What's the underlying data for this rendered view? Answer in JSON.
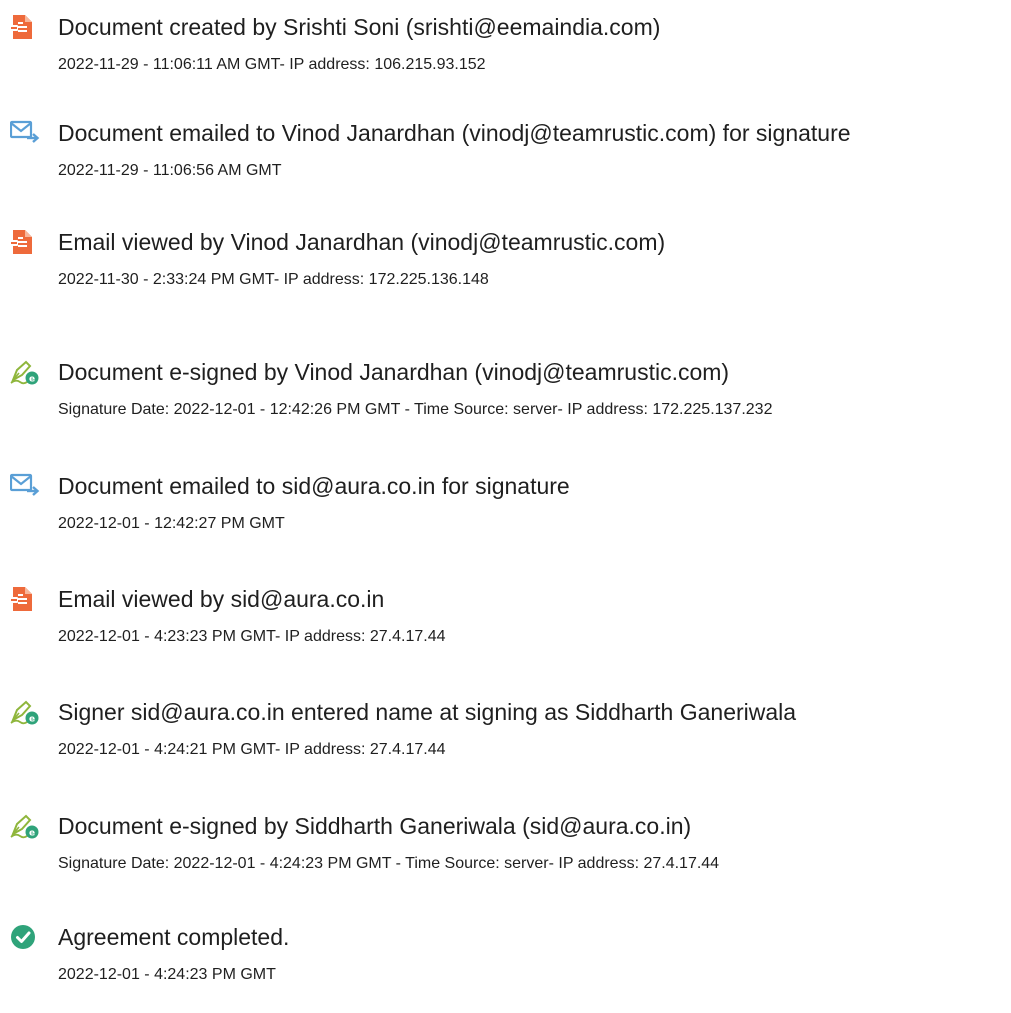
{
  "colors": {
    "doc_icon": "#ee6a3b",
    "mail_icon": "#5a9fd6",
    "sign_icon_pen": "#8fb63c",
    "sign_icon_badge": "#2fa37a",
    "complete_icon": "#2fa37a",
    "text": "#1f1f1f"
  },
  "events": [
    {
      "icon": "document-icon",
      "title": "Document created by Srishti Soni (srishti@eemaindia.com)",
      "detail": "2022-11-29 - 11:06:11 AM GMT- IP address: 106.215.93.152"
    },
    {
      "icon": "email-sent-icon",
      "title": "Document emailed to Vinod Janardhan (vinodj@teamrustic.com) for signature",
      "detail": "2022-11-29 - 11:06:56 AM GMT"
    },
    {
      "icon": "document-icon",
      "title": "Email viewed by Vinod Janardhan (vinodj@teamrustic.com)",
      "detail": "2022-11-30 - 2:33:24 PM GMT- IP address: 172.225.136.148"
    },
    {
      "icon": "esign-pen-icon",
      "title": "Document e-signed by Vinod Janardhan (vinodj@teamrustic.com)",
      "detail": "Signature Date: 2022-12-01 - 12:42:26 PM GMT - Time Source: server- IP address: 172.225.137.232"
    },
    {
      "icon": "email-sent-icon",
      "title": "Document emailed to sid@aura.co.in for signature",
      "detail": "2022-12-01 - 12:42:27 PM GMT"
    },
    {
      "icon": "document-icon",
      "title": "Email viewed by sid@aura.co.in",
      "detail": "2022-12-01 - 4:23:23 PM GMT- IP address: 27.4.17.44"
    },
    {
      "icon": "esign-pen-icon",
      "title": "Signer sid@aura.co.in entered name at signing as Siddharth Ganeriwala",
      "detail": "2022-12-01 - 4:24:21 PM GMT- IP address: 27.4.17.44"
    },
    {
      "icon": "esign-pen-icon",
      "title": "Document e-signed by Siddharth Ganeriwala (sid@aura.co.in)",
      "detail": "Signature Date: 2022-12-01 - 4:24:23 PM GMT - Time Source: server- IP address: 27.4.17.44"
    },
    {
      "icon": "checkmark-circle-icon",
      "title": "Agreement completed.",
      "detail": "2022-12-01 - 4:24:23 PM GMT"
    }
  ]
}
